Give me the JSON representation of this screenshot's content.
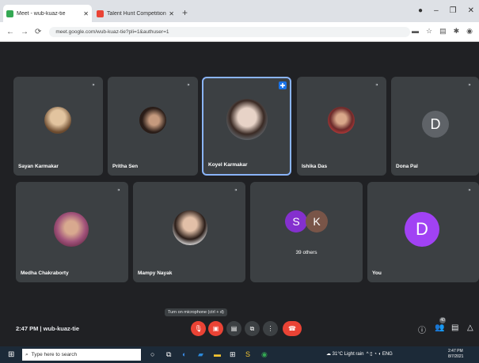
{
  "browser": {
    "tabs": [
      {
        "title": "Meet - wub-kuaz-tie",
        "favicon_color": "#34a853"
      },
      {
        "title": "Talent Hunt Competition 1st pri",
        "favicon_color": "#ea4335"
      }
    ],
    "url": "meet.google.com/wub-kuaz-tie?pli=1&authuser=1"
  },
  "participants": [
    {
      "name": "Sayan Karmakar",
      "avatar": "photo",
      "color": "#c9a27a"
    },
    {
      "name": "Pritha Sen",
      "avatar": "photo",
      "color": "#3b2b24"
    },
    {
      "name": "Koyel Karmakar",
      "avatar": "photo",
      "color": "#d8c4b8"
    },
    {
      "name": "Ishika Das",
      "avatar": "photo",
      "color": "#6b2a2a"
    },
    {
      "name": "Dona Pal",
      "avatar": "letter",
      "letter": "D",
      "color": "#5f6368"
    },
    {
      "name": "Medha Chakraborty",
      "avatar": "photo",
      "color": "#a0527a"
    },
    {
      "name": "Mampy Nayak",
      "avatar": "photo",
      "color": "#8b6a55"
    },
    {
      "name": "39 others",
      "avatar": "group",
      "letters": [
        "S",
        "K"
      ],
      "colors": [
        "#8430ce",
        "#795548"
      ]
    },
    {
      "name": "You",
      "avatar": "letter",
      "letter": "D",
      "color": "#a142f4"
    }
  ],
  "controls": {
    "tooltip": "Turn on microphone (ctrl + d)",
    "time_meeting": "2:47 PM | wub-kuaz-tie",
    "people_badge": "40"
  },
  "taskbar": {
    "search_placeholder": "Type here to search",
    "weather": "31°C Light rain",
    "lang": "ENG",
    "time": "2:47 PM",
    "date": "8/7/2021"
  }
}
